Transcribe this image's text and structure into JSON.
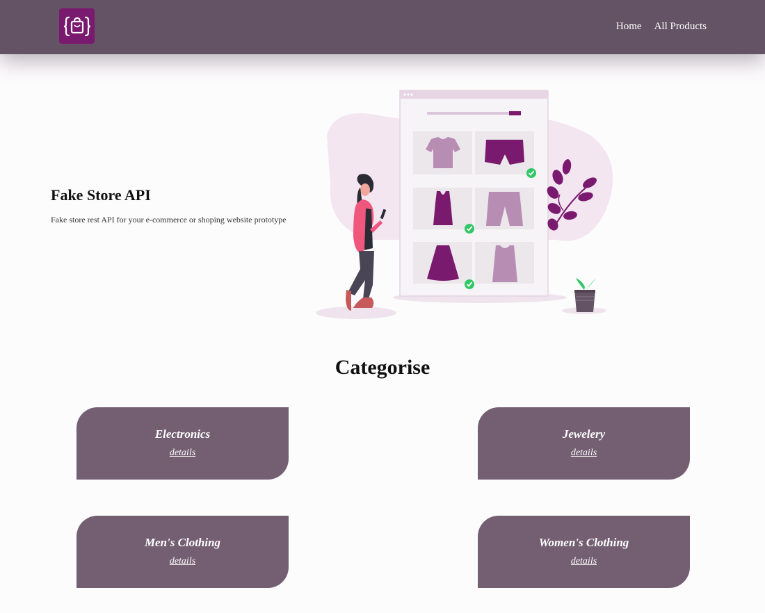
{
  "navbar": {
    "logo_icon": "shopping-bag-braces-icon",
    "links": [
      {
        "label": "Home"
      },
      {
        "label": "All Products"
      }
    ]
  },
  "hero": {
    "title": "Fake Store API",
    "subtitle": "Fake store rest API for your e-commerce or shoping website prototype",
    "illustration": "online-shopping-illustration"
  },
  "categories": {
    "title": "Categorise",
    "items": [
      {
        "name": "Electronics",
        "link": "details"
      },
      {
        "name": "Jewelery",
        "link": "details"
      },
      {
        "name": "Men's Clothing",
        "link": "details"
      },
      {
        "name": "Women's Clothing",
        "link": "details"
      }
    ]
  },
  "colors": {
    "navbar": "#645364",
    "logo": "#7a1a6e",
    "card": "#735e72",
    "accent": "#7a1a6e"
  }
}
